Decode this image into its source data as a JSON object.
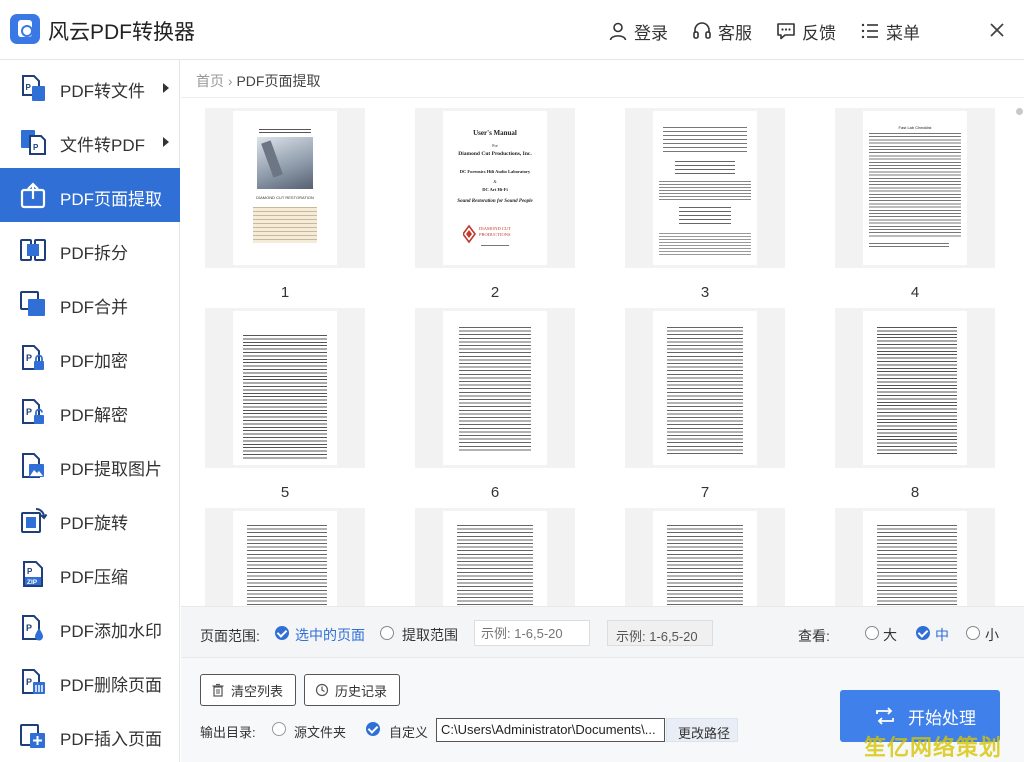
{
  "app": {
    "title": "风云PDF转换器"
  },
  "header": {
    "login": "登录",
    "support": "客服",
    "feedback": "反馈",
    "menu": "菜单"
  },
  "sidebar": {
    "items": [
      {
        "label": "PDF转文件",
        "icon": "pdf-to-file-icon",
        "submenu": true
      },
      {
        "label": "文件转PDF",
        "icon": "file-to-pdf-icon",
        "submenu": true
      },
      {
        "label": "PDF页面提取",
        "icon": "extract-page-icon",
        "active": true
      },
      {
        "label": "PDF拆分",
        "icon": "split-icon"
      },
      {
        "label": "PDF合并",
        "icon": "merge-icon"
      },
      {
        "label": "PDF加密",
        "icon": "encrypt-icon"
      },
      {
        "label": "PDF解密",
        "icon": "decrypt-icon"
      },
      {
        "label": "PDF提取图片",
        "icon": "extract-image-icon"
      },
      {
        "label": "PDF旋转",
        "icon": "rotate-icon"
      },
      {
        "label": "PDF压缩",
        "icon": "compress-icon"
      },
      {
        "label": "PDF添加水印",
        "icon": "watermark-icon"
      },
      {
        "label": "PDF删除页面",
        "icon": "delete-page-icon"
      },
      {
        "label": "PDF插入页面",
        "icon": "insert-page-icon"
      }
    ]
  },
  "breadcrumb": {
    "home": "首页",
    "separator": "›",
    "current": "PDF页面提取"
  },
  "pages": {
    "numbers": [
      "1",
      "2",
      "3",
      "4",
      "5",
      "6",
      "7",
      "8",
      "",
      "",
      "",
      ""
    ],
    "page1_caption": "DIAMOND CUT RESTORATION",
    "page2": {
      "title": "User's Manual",
      "for": "For",
      "company": "Diamond Cut Productions, Inc.",
      "product": "DC Forensics Hifi Audio Laboratory",
      "and": "&",
      "live": "DC Art Hi-Fi",
      "tagline": "Sound Restoration for Sound People",
      "logo": "DIAMOND CUT PRODUCTIONS"
    },
    "page4_title": "Fast Lab Checklist"
  },
  "options": {
    "range_label": "页面范围:",
    "selected_pages": "选中的页面",
    "extract_range": "提取范围",
    "range_placeholder": "示例: 1-6,5-20",
    "example": "示例: 1-6,5-20",
    "view_label": "查看:",
    "size_large": "大",
    "size_medium": "中",
    "size_small": "小"
  },
  "bottom": {
    "clear_list": "清空列表",
    "history": "历史记录",
    "output_dir_label": "输出目录:",
    "source_folder": "源文件夹",
    "custom": "自定义",
    "output_path": "C:\\Users\\Administrator\\Documents\\...",
    "change_path": "更改路径",
    "start": "开始处理"
  },
  "watermark": "笙亿网络策划",
  "colors": {
    "accent": "#2f6fd6",
    "start_button": "#3f80ea",
    "watermark": "#d6c400"
  }
}
